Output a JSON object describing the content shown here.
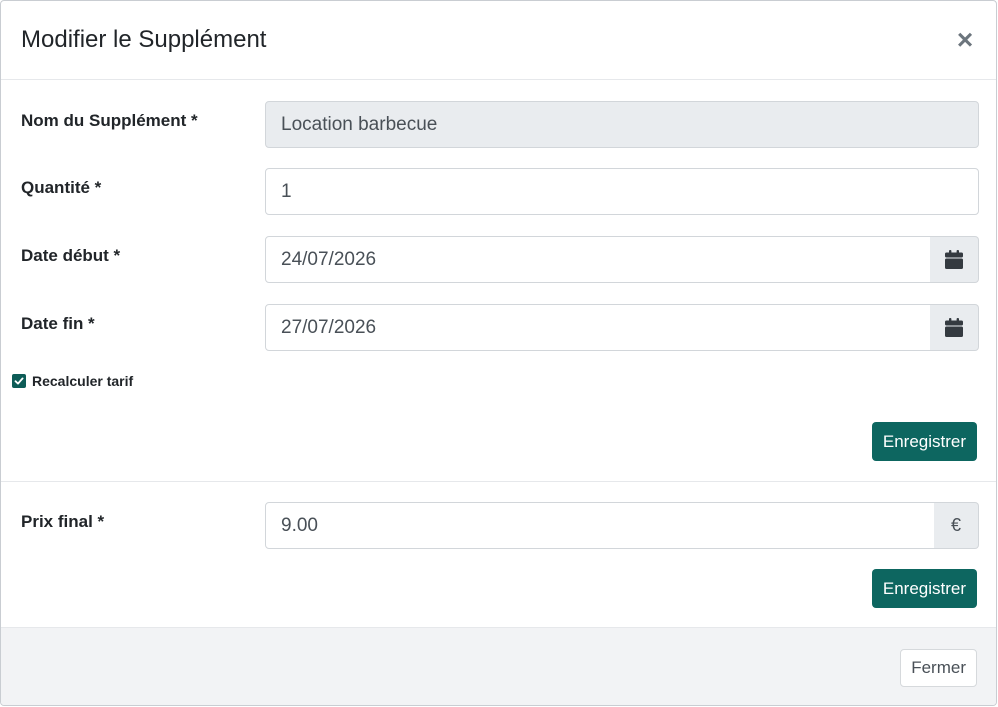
{
  "modal": {
    "title": "Modifier le Supplément",
    "close_glyph": "×"
  },
  "form": {
    "name": {
      "label": "Nom du Supplément *",
      "value": "Location barbecue"
    },
    "quantity": {
      "label": "Quantité *",
      "value": "1"
    },
    "start_date": {
      "label": "Date début *",
      "value": "24/07/2026",
      "icon": "calendar-icon"
    },
    "end_date": {
      "label": "Date fin *",
      "value": "27/07/2026",
      "icon": "calendar-icon"
    },
    "recalculate": {
      "label": "Recalculer tarif",
      "checked": true
    },
    "save_label": "Enregistrer"
  },
  "price": {
    "label": "Prix final *",
    "value": "9.00",
    "currency": "€",
    "save_label": "Enregistrer"
  },
  "footer": {
    "close_label": "Fermer"
  },
  "colors": {
    "accent": "#0d6660",
    "readonly_bg": "#e9ecef",
    "footer_bg": "#f2f3f5"
  }
}
